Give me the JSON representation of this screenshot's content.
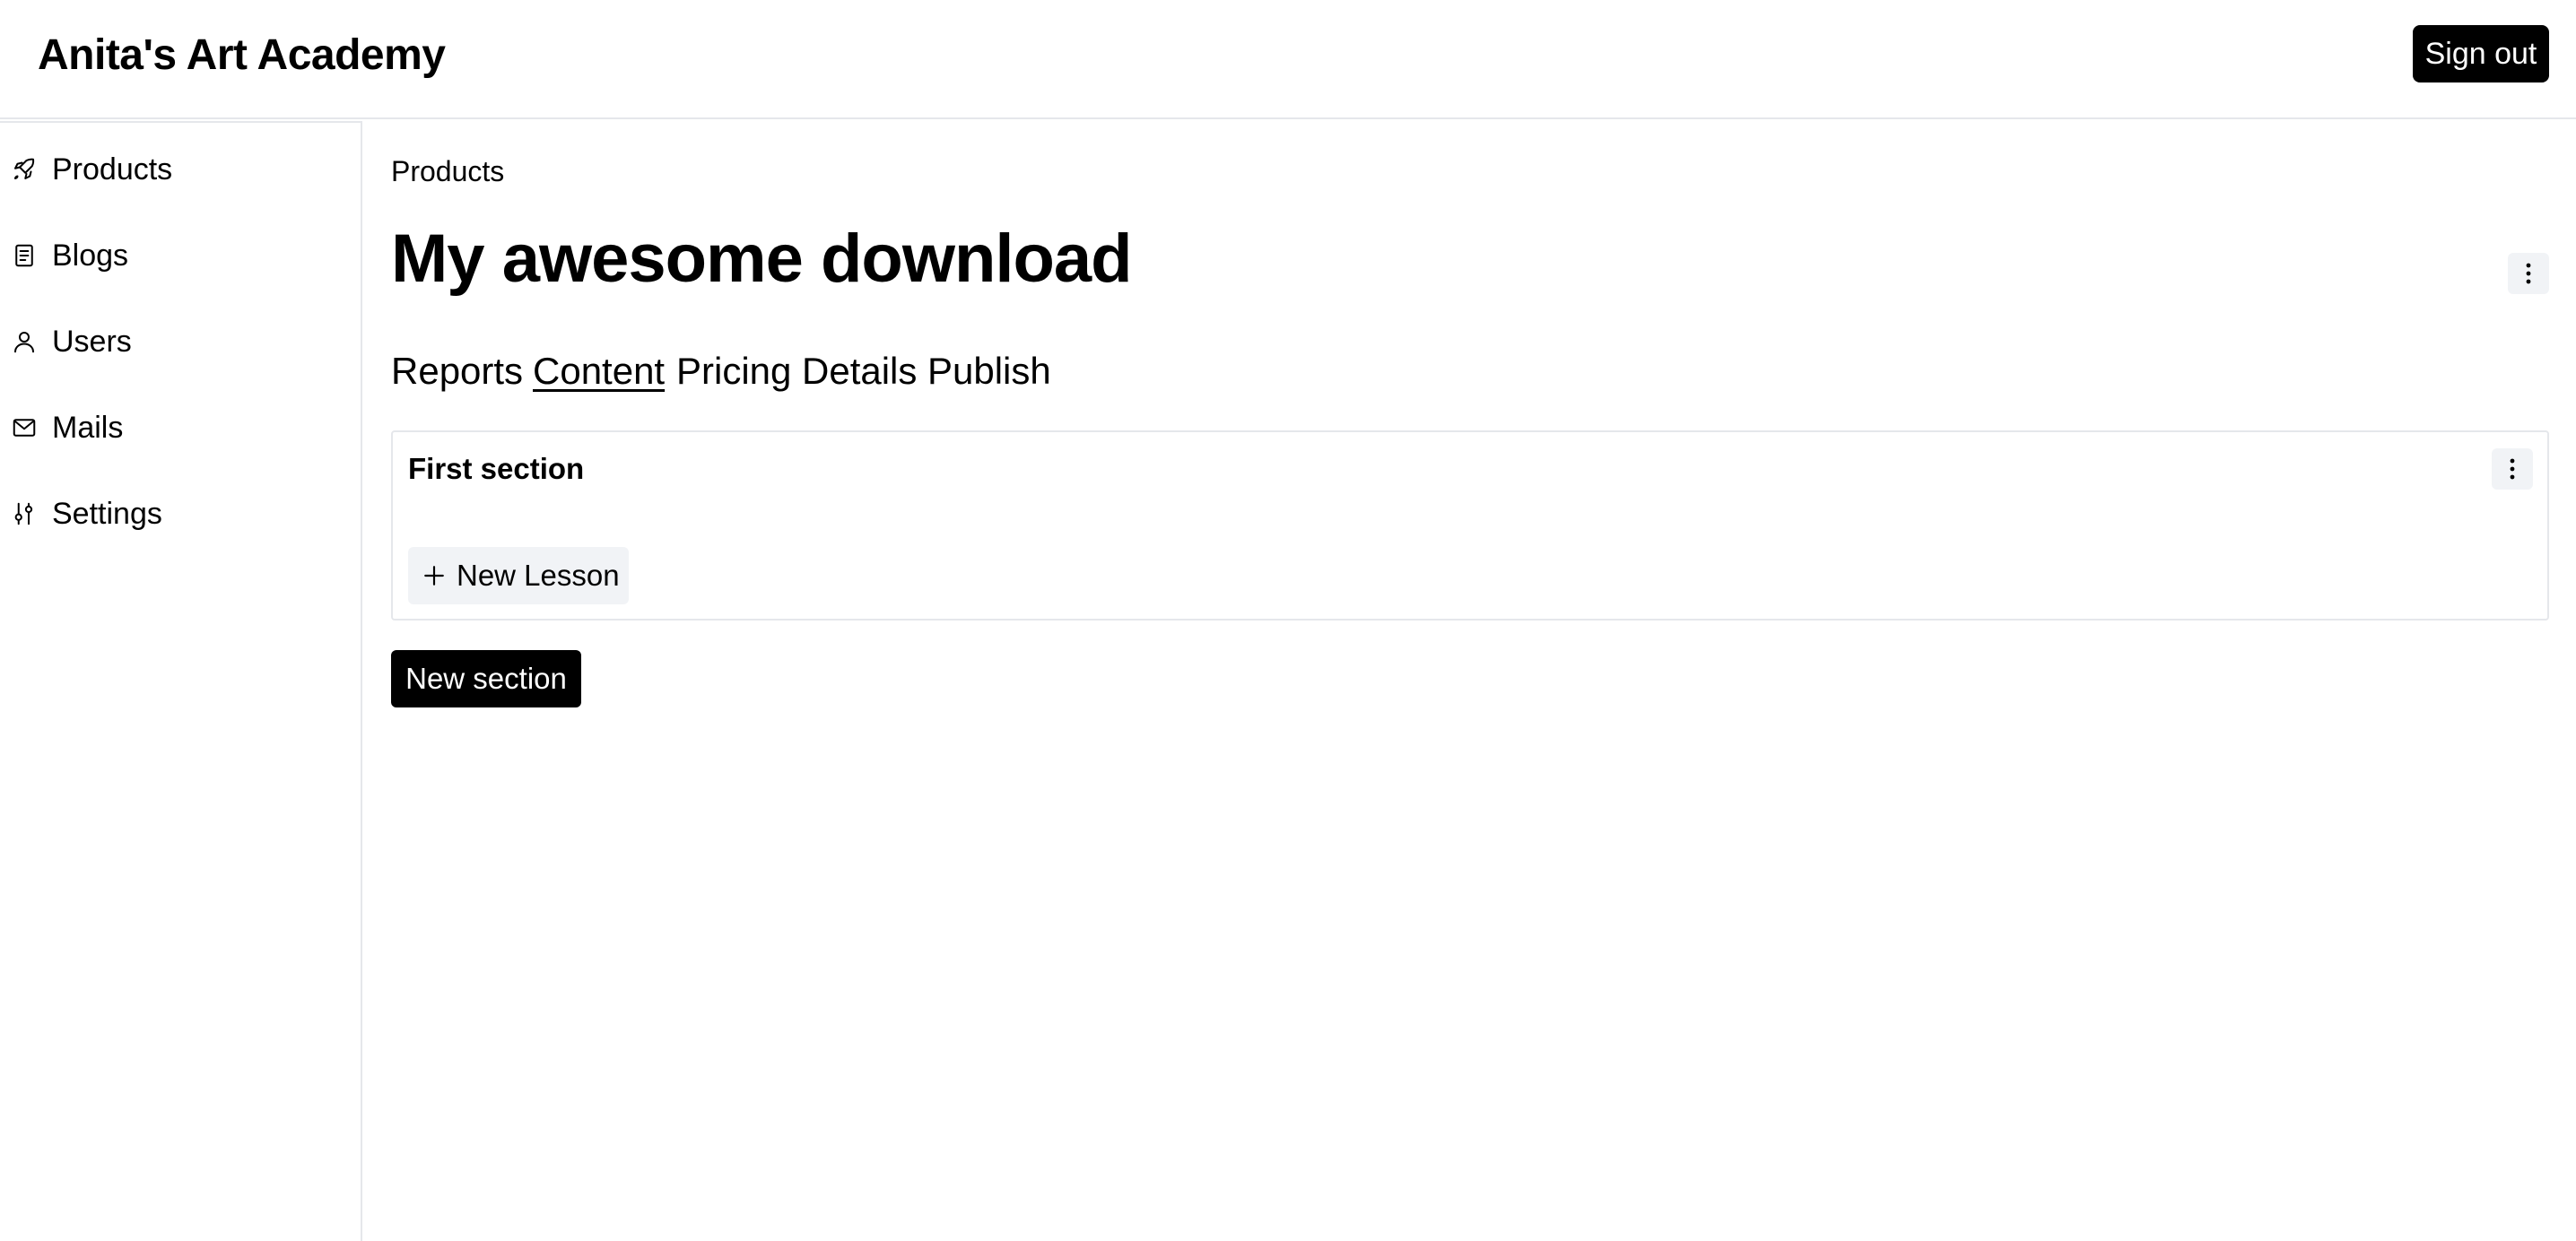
{
  "header": {
    "brand": "Anita's Art Academy",
    "signout_label": "Sign out"
  },
  "sidebar": {
    "items": [
      {
        "label": "Products",
        "icon": "rocket-icon"
      },
      {
        "label": "Blogs",
        "icon": "document-icon"
      },
      {
        "label": "Users",
        "icon": "user-icon"
      },
      {
        "label": "Mails",
        "icon": "mail-icon"
      },
      {
        "label": "Settings",
        "icon": "sliders-icon"
      }
    ]
  },
  "main": {
    "breadcrumb": "Products",
    "title": "My awesome download",
    "tabs": [
      {
        "label": "Reports",
        "active": false
      },
      {
        "label": "Content",
        "active": true
      },
      {
        "label": "Pricing",
        "active": false
      },
      {
        "label": "Details",
        "active": false
      },
      {
        "label": "Publish",
        "active": false
      }
    ],
    "sections": [
      {
        "title": "First section",
        "new_lesson_label": "New Lesson"
      }
    ],
    "new_section_label": "New section"
  }
}
